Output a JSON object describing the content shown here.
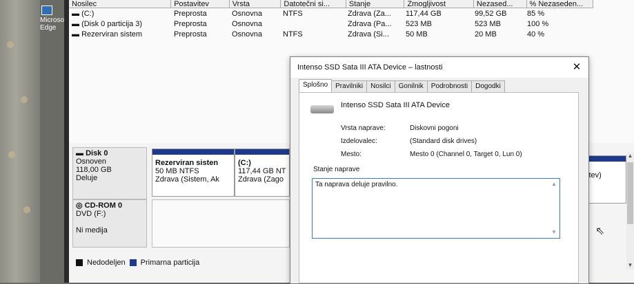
{
  "desktop": {
    "edge_label": "Microsoft Edge"
  },
  "volumes": {
    "headers": [
      "Nosilec",
      "Postavitev",
      "Vrsta",
      "Datotečni si...",
      "Stanje",
      "Zmogljivost",
      "Nezased...",
      "% Nezaseden..."
    ],
    "rows": [
      [
        "(C:)",
        "Preprosta",
        "Osnovna",
        "NTFS",
        "Zdrava (Za...",
        "117,44 GB",
        "99,52 GB",
        "85 %"
      ],
      [
        "(Disk 0 particija 3)",
        "Preprosta",
        "Osnovna",
        "",
        "Zdrava (Pa...",
        "523 MB",
        "523 MB",
        "100 %"
      ],
      [
        "Rezerviran sistem",
        "Preprosta",
        "Osnovna",
        "NTFS",
        "Zdrava (Si...",
        "50 MB",
        "20 MB",
        "40 %"
      ]
    ]
  },
  "disks": {
    "disk0": {
      "name": "Disk 0",
      "type": "Osnoven",
      "size": "118,00 GB",
      "status": "Deluje"
    },
    "cdrom0": {
      "name": "CD-ROM 0",
      "type": "DVD (F:)",
      "status": "Ni medija"
    },
    "partitions": [
      {
        "name": "Rezerviran sisten",
        "size": "50 MB NTFS",
        "status": "Zdrava (Sistem, Ak"
      },
      {
        "name": "(C:)",
        "size": "117,44 GB NT",
        "status": "Zdrava (Zago"
      }
    ],
    "right_fragment": "itev)"
  },
  "legend": {
    "unallocated": "Nedodeljen",
    "primary": "Primarna particija"
  },
  "colors": {
    "unallocated": "#111111",
    "primary": "#1f3a8a"
  },
  "dialog": {
    "title": "Intenso SSD Sata III ATA Device – lastnosti",
    "close_icon": "close-icon",
    "tabs": [
      "Splošno",
      "Pravilniki",
      "Nosilci",
      "Gonilnik",
      "Podrobnosti",
      "Dogodki"
    ],
    "device_name": "Intenso SSD Sata III ATA Device",
    "props": [
      {
        "label": "Vrsta naprave:",
        "value": "Diskovni pogoni"
      },
      {
        "label": "Izdelovalec:",
        "value": "(Standard disk drives)"
      },
      {
        "label": "Mesto:",
        "value": "Mesto 0 (Channel 0, Target 0, Lun 0)"
      }
    ],
    "status_group": "Stanje naprave",
    "status_text": "Ta naprava deluje pravilno."
  }
}
